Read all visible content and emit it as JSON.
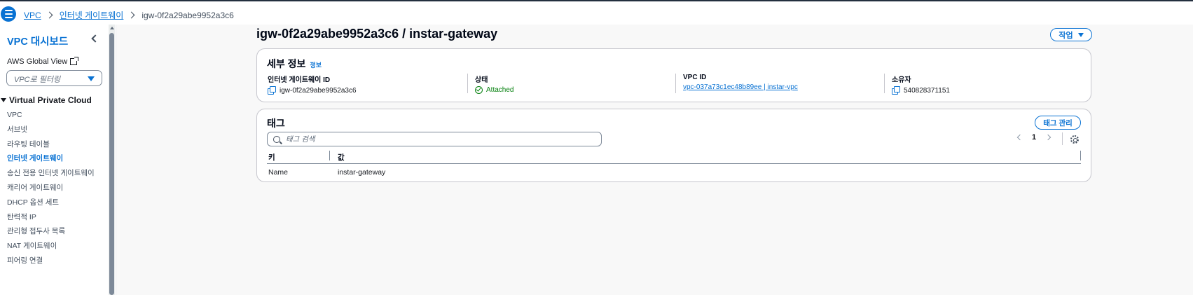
{
  "breadcrumb": {
    "items": [
      "VPC",
      "인터넷 게이트웨이"
    ],
    "current": "igw-0f2a29abe9952a3c6"
  },
  "sidebar": {
    "title": "VPC 대시보드",
    "global_view": "AWS Global View",
    "filter_placeholder": "VPC로 필터링",
    "section": "Virtual Private Cloud",
    "items": [
      {
        "label": "VPC"
      },
      {
        "label": "서브넷"
      },
      {
        "label": "라우팅 테이블"
      },
      {
        "label": "인터넷 게이트웨이"
      },
      {
        "label": "송신 전용 인터넷 게이트웨이"
      },
      {
        "label": "캐리어 게이트웨이"
      },
      {
        "label": "DHCP 옵션 세트"
      },
      {
        "label": "탄력적 IP"
      },
      {
        "label": "관리형 접두사 목록"
      },
      {
        "label": "NAT 게이트웨이"
      },
      {
        "label": "피어링 연결"
      }
    ],
    "active_item": "인터넷 게이트웨이"
  },
  "page": {
    "title": "igw-0f2a29abe9952a3c6 / instar-gateway",
    "action_label": "작업"
  },
  "details": {
    "title": "세부 정보",
    "info_link": "정보",
    "fields": [
      {
        "label": "인터넷 게이트웨이 ID",
        "value": "igw-0f2a29abe9952a3c6"
      },
      {
        "label": "상태",
        "value": "Attached"
      },
      {
        "label": "VPC ID",
        "value": "vpc-037a73c1ec48b89ee | instar-vpc"
      },
      {
        "label": "소유자",
        "value": "540828371151"
      }
    ]
  },
  "tags": {
    "title": "태그",
    "manage_label": "태그 관리",
    "search_placeholder": "태그 검색",
    "page_number": "1",
    "columns": [
      "키",
      "값"
    ],
    "rows": [
      {
        "key": "Name",
        "value": "instar-gateway"
      }
    ]
  },
  "colors": {
    "link": "#0972d3",
    "success": "#037f0c",
    "border": "#c6c6cd"
  },
  "icons": [
    "menu-icon",
    "chevron-right-icon",
    "close-sidebar-icon",
    "external-link-icon",
    "caret-down-icon",
    "copy-icon",
    "check-circle-icon",
    "search-icon",
    "chevron-left-icon",
    "gear-icon"
  ]
}
